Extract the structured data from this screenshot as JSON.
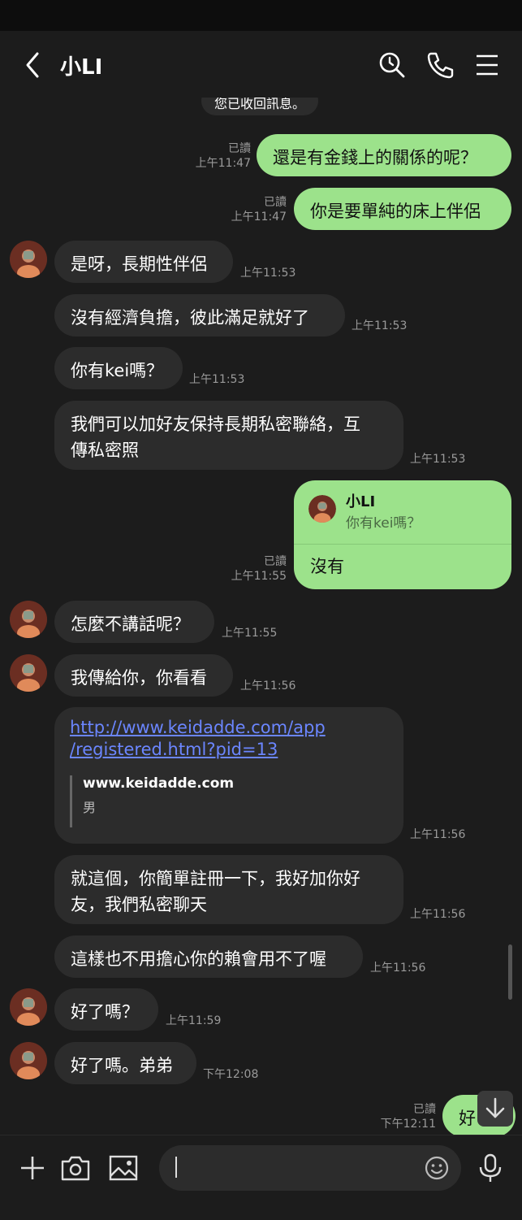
{
  "header": {
    "title": "小LI"
  },
  "system_message": "您已收回訊息。",
  "read_label": "已讀",
  "messages": [
    {
      "text": "還是有金錢上的關係的呢？",
      "time": "上午11:47"
    },
    {
      "text": "你是要單純的床上伴侶",
      "time": "上午11:47"
    },
    {
      "text": "是呀，長期性伴侶",
      "time": "上午11:53"
    },
    {
      "text": "沒有經濟負擔，彼此滿足就好了",
      "time": "上午11:53"
    },
    {
      "text": "你有kei嗎？",
      "time": "上午11:53"
    },
    {
      "text_line1": "我們可以加好友保持長期私密聯絡，互",
      "text_line2": "傳私密照",
      "time": "上午11:53"
    },
    {
      "reply_name": "小LI",
      "reply_quote": "你有kei嗎？",
      "text": "沒有",
      "time": "上午11:55"
    },
    {
      "text": "怎麼不講話呢？",
      "time": "上午11:55"
    },
    {
      "text": "我傳給你，你看看",
      "time": "上午11:56"
    },
    {
      "link_line1": "http://www.keidadde.com/app",
      "link_line2": "/registered.html?pid=13",
      "preview_site": "www.keidadde.com",
      "preview_desc": "男",
      "time": "上午11:56"
    },
    {
      "text_line1": "就這個，你簡單註冊一下，我好加你好",
      "text_line2": "友，我們私密聊天",
      "time": "上午11:56"
    },
    {
      "text": "這樣也不用擔心你的賴會用不了喔",
      "time": "上午11:56"
    },
    {
      "text": "好了嗎？",
      "time": "上午11:59"
    },
    {
      "text": "好了嗎。弟弟",
      "time": "下午12:08"
    },
    {
      "text": "好",
      "time": "下午12:11"
    }
  ],
  "colors": {
    "outgoing": "#9ce28b",
    "incoming": "#2c2c2c",
    "background": "#1c1c1c",
    "link": "#6b86ff"
  }
}
